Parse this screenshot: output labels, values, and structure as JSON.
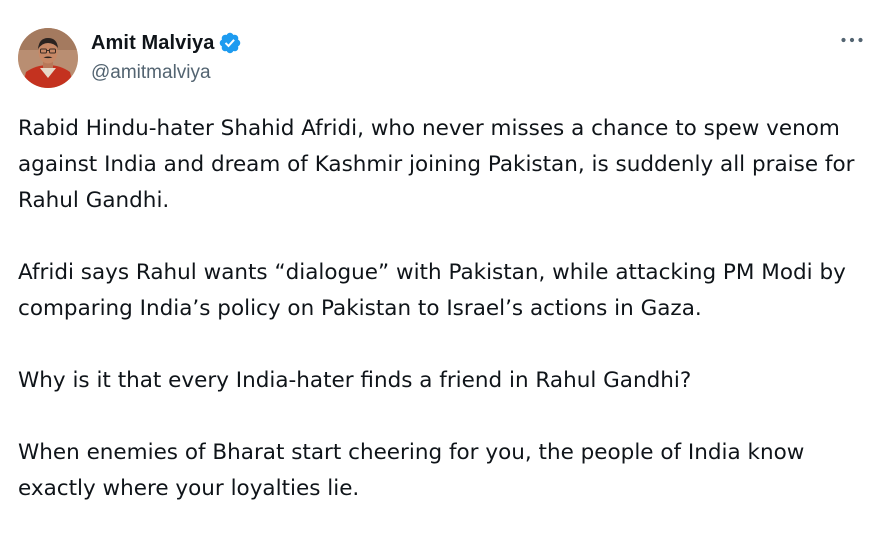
{
  "author": {
    "display_name": "Amit Malviya",
    "handle": "@amitmalviya",
    "verified": true
  },
  "icons": {
    "verified": "verified-badge-icon",
    "more": "more-horizontal-icon",
    "avatar": "avatar-photo"
  },
  "colors": {
    "verified_blue": "#1d9bf0",
    "text": "#0f1419",
    "secondary": "#536471"
  },
  "tweet": {
    "paragraphs": [
      "Rabid Hindu-hater Shahid Afridi, who never misses a chance to spew venom against India and dream of Kashmir joining Pakistan, is suddenly all praise for Rahul Gandhi.",
      "Afridi says Rahul wants “dialogue” with Pakistan, while attacking PM Modi by comparing India’s policy on Pakistan to Israel’s actions in Gaza.",
      "Why is it that every India-hater finds a friend in Rahul Gandhi?",
      "When enemies of Bharat start cheering for you, the people of India know exactly where your loyalties lie."
    ]
  }
}
